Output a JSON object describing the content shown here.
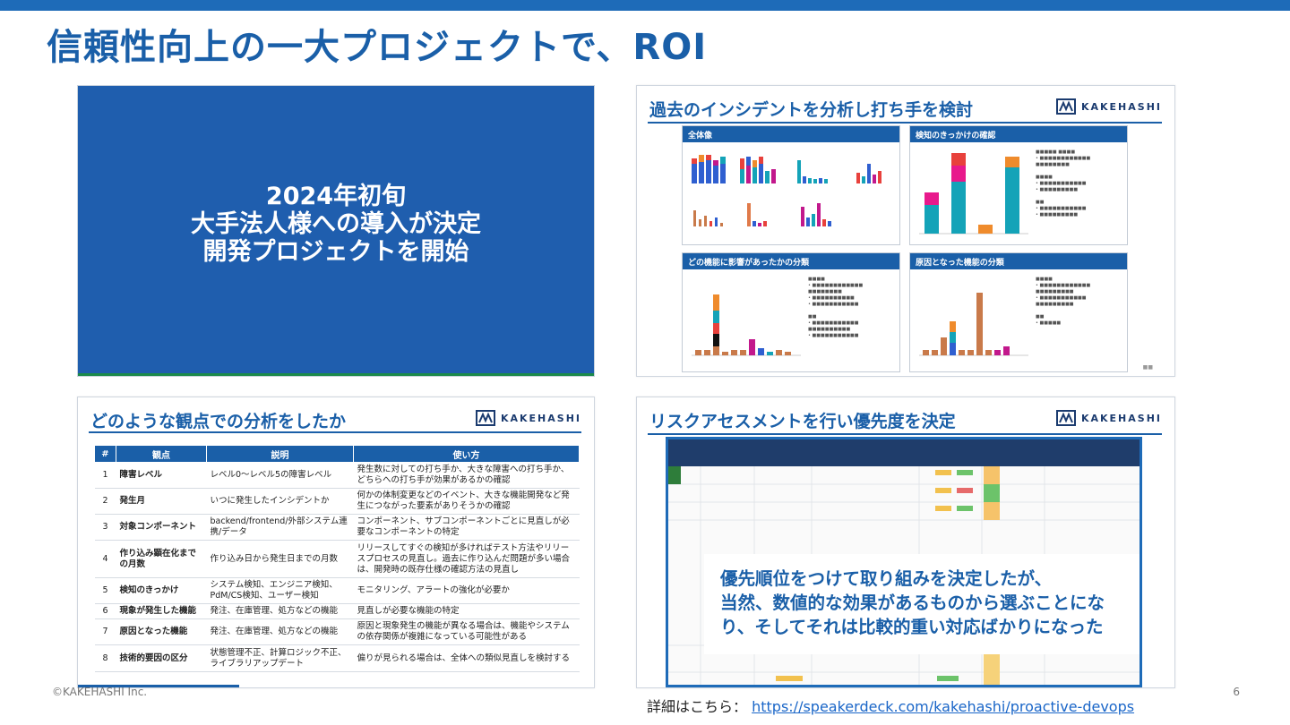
{
  "slide": {
    "title": "信頼性向上の一大プロジェクトで、ROI",
    "copyright": "©KAKEHASHI Inc.",
    "page_number": "6",
    "details_label": "詳細はこちら：",
    "details_link": "https://speakerdeck.com/kakehashi/proactive-devops"
  },
  "panel1": {
    "line1": "2024年初旬",
    "line2": "大手法人様への導入が決定",
    "line3": "開発プロジェクトを開始"
  },
  "panel2": {
    "title": "過去のインシデントを分析し打ち手を検討",
    "logo": "KAKEHASHI",
    "tiles": [
      "全体像",
      "検知のきっかけの確認",
      "どの機能に影響があったかの分類",
      "原因となった機能の分類"
    ]
  },
  "panel3": {
    "title": "どのような観点での分析をしたか",
    "logo": "KAKEHASHI",
    "headers": [
      "#",
      "観点",
      "説明",
      "使い方"
    ],
    "rows": [
      [
        "1",
        "障害レベル",
        "レベル0〜レベル5の障害レベル",
        "発生数に対しての打ち手か、大きな障害への打ち手か、どちらへの打ち手が効果があるかの確認"
      ],
      [
        "2",
        "発生月",
        "いつに発生したインシデントか",
        "何かの体制変更などのイベント、大きな機能開発など発生につながった要素がありそうかの確認"
      ],
      [
        "3",
        "対象コンポーネント",
        "backend/frontend/外部システム連携/データ",
        "コンポーネント、サブコンポーネントごとに見直しが必要なコンポーネントの特定"
      ],
      [
        "4",
        "作り込み顕在化までの月数",
        "作り込み日から発生日までの月数",
        "リリースしてすぐの検知が多ければテスト方法やリリースプロセスの見直し。過去に作り込んだ問題が多い場合は、開発時の既存仕様の確認方法の見直し"
      ],
      [
        "5",
        "検知のきっかけ",
        "システム検知、エンジニア検知、PdM/CS検知、ユーザー検知",
        "モニタリング、アラートの強化が必要か"
      ],
      [
        "6",
        "現象が発生した機能",
        "発注、在庫管理、処方などの機能",
        "見直しが必要な機能の特定"
      ],
      [
        "7",
        "原因となった機能",
        "発注、在庫管理、処方などの機能",
        "原因と現象発生の機能が異なる場合は、機能やシステムの依存関係が複雑になっている可能性がある"
      ],
      [
        "8",
        "技術的要因の区分",
        "状態管理不正、計算ロジック不正、ライブラリアップデート",
        "偏りが見られる場合は、全体への類似見直しを検討する"
      ]
    ]
  },
  "panel4": {
    "title": "リスクアセスメントを行い優先度を決定",
    "logo": "KAKEHASHI",
    "overlay_lines": [
      "優先順位をつけて取り組みを決定したが、",
      "当然、数値的な効果があるものから選ぶことにな",
      "り、そしてそれは比較的重い対応ばかりになった"
    ]
  }
}
